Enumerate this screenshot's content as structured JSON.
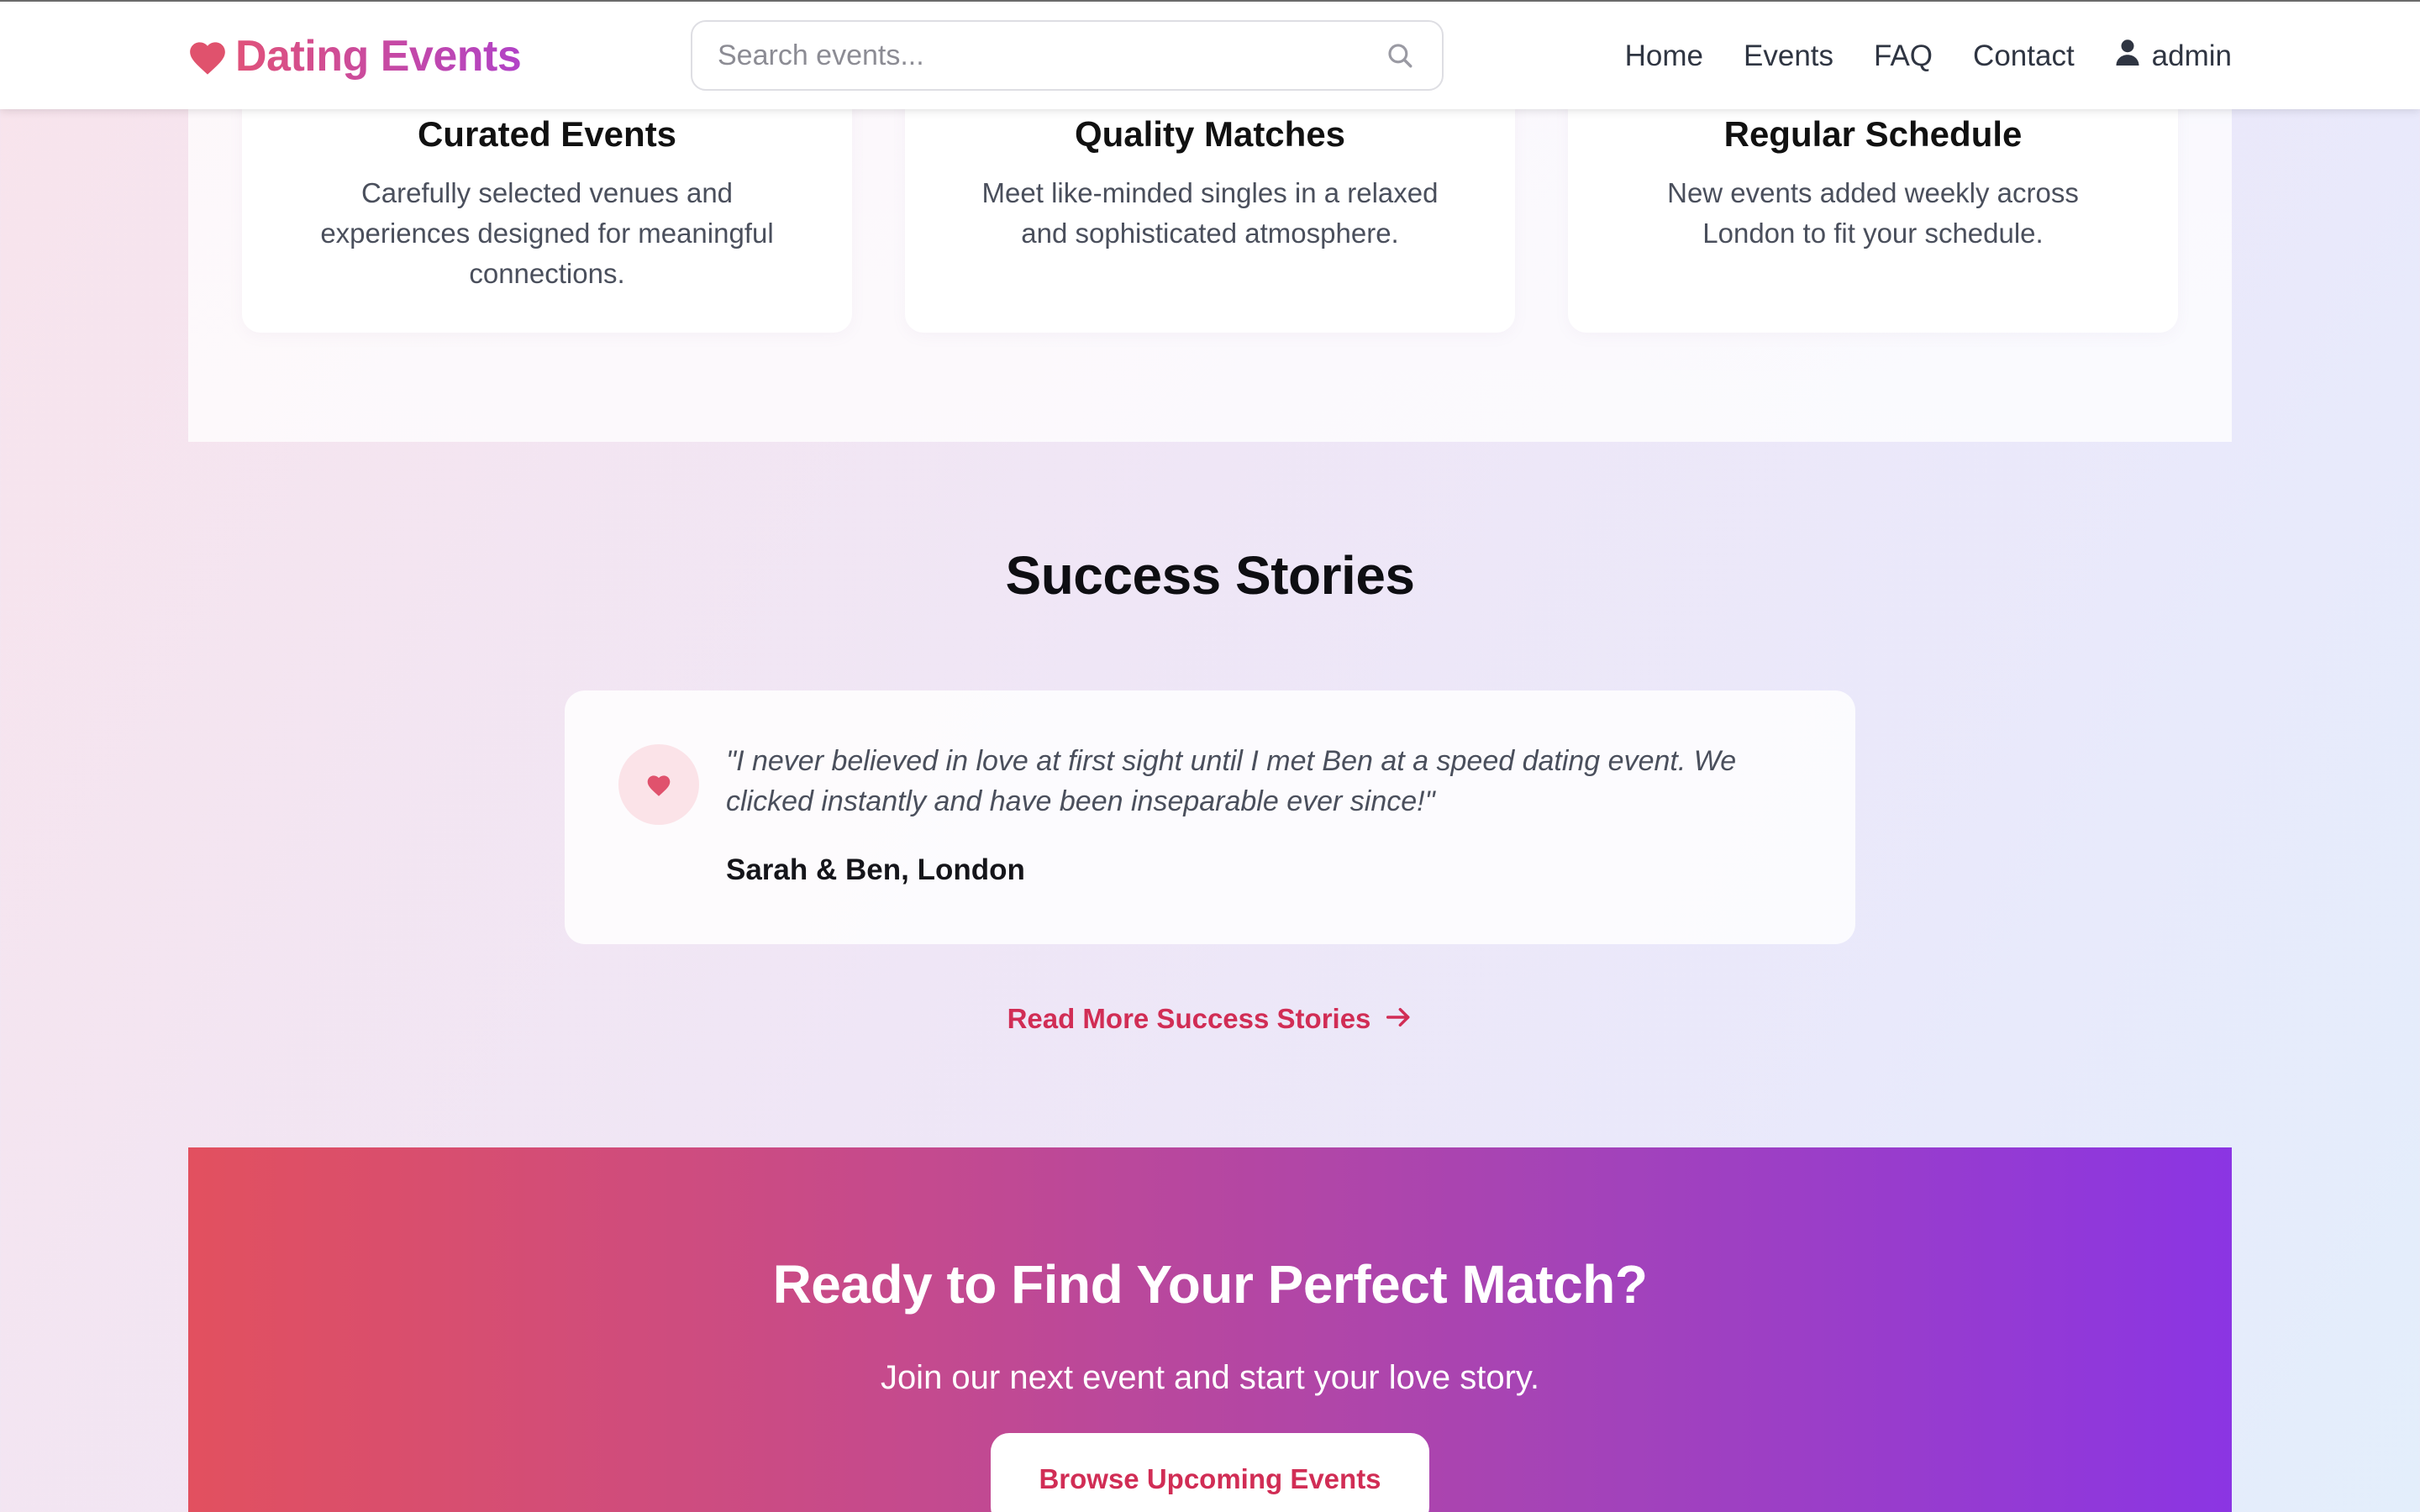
{
  "brand": {
    "name": "Dating Events",
    "icon": "heart-icon",
    "gradient": [
      "#e0527a",
      "#b142c7"
    ]
  },
  "search": {
    "placeholder": "Search events...",
    "value": "",
    "icon": "search-icon"
  },
  "nav": {
    "links": [
      "Home",
      "Events",
      "FAQ",
      "Contact"
    ],
    "user": {
      "icon": "user-icon",
      "name": "admin"
    }
  },
  "features": [
    {
      "title": "Curated Events",
      "description": "Carefully selected venues and experiences designed for meaningful connections."
    },
    {
      "title": "Quality Matches",
      "description": "Meet like-minded singles in a relaxed and sophisticated atmosphere."
    },
    {
      "title": "Regular Schedule",
      "description": "New events added weekly across London to fit your schedule."
    }
  ],
  "stories": {
    "title": "Success Stories",
    "testimonial": {
      "icon": "heart-icon",
      "quote": "\"I never believed in love at first sight until I met Ben at a speed dating event. We clicked instantly and have been inseparable ever since!\"",
      "author": "Sarah & Ben, London"
    },
    "read_more": {
      "label": "Read More Success Stories",
      "icon": "arrow-right-icon"
    }
  },
  "cta": {
    "title": "Ready to Find Your Perfect Match?",
    "subtitle": "Join our next event and start your love story.",
    "button_label": "Browse Upcoming Events",
    "gradient": [
      "#e2505f",
      "#8b35e3"
    ]
  },
  "colors": {
    "accent": "#d12d55",
    "heart": "#e0526d",
    "text_dark": "#111111",
    "text_muted": "#4a4f5c"
  }
}
